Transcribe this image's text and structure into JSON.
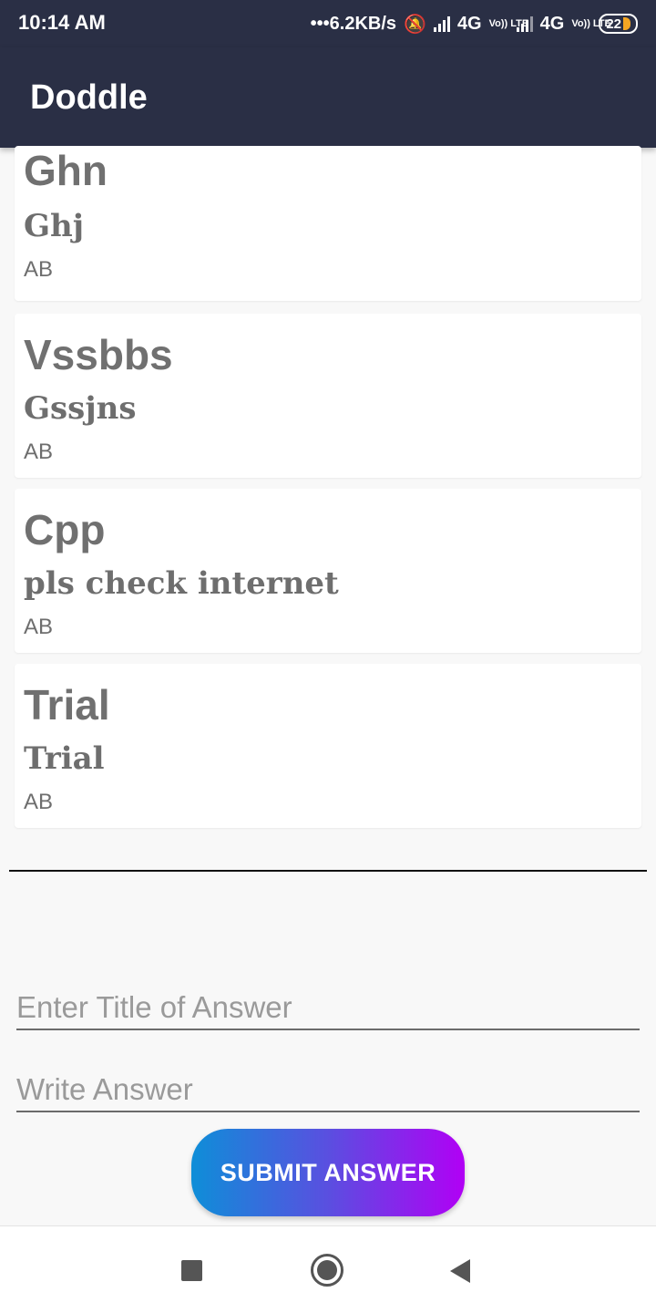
{
  "status_bar": {
    "time": "10:14 AM",
    "network_speed": "•••6.2KB/s",
    "network_1": "4G",
    "network_2": "4G",
    "volte_label": "Vo)) LTE",
    "battery": "22"
  },
  "app_bar": {
    "title": "Doddle"
  },
  "answers": [
    {
      "title": "Ghn",
      "body": "Ghj",
      "author": "AB"
    },
    {
      "title": "Vssbbs",
      "body": "Gssjns",
      "author": "AB"
    },
    {
      "title": "Cpp",
      "body": "pls check internet",
      "author": "AB"
    },
    {
      "title": "Trial",
      "body": "Trial",
      "author": "AB"
    }
  ],
  "form": {
    "title_placeholder": "Enter Title of Answer",
    "answer_placeholder": "Write Answer",
    "submit_label": "SUBMIT ANSWER"
  },
  "colors": {
    "app_bar": "#2a2f45",
    "button_gradient_start": "#0e8ed8",
    "button_gradient_end": "#b100f5"
  },
  "icons": {
    "status": [
      "signal-icon",
      "mute-icon",
      "battery-icon"
    ],
    "nav": [
      "recents-icon",
      "home-icon",
      "back-icon"
    ]
  }
}
